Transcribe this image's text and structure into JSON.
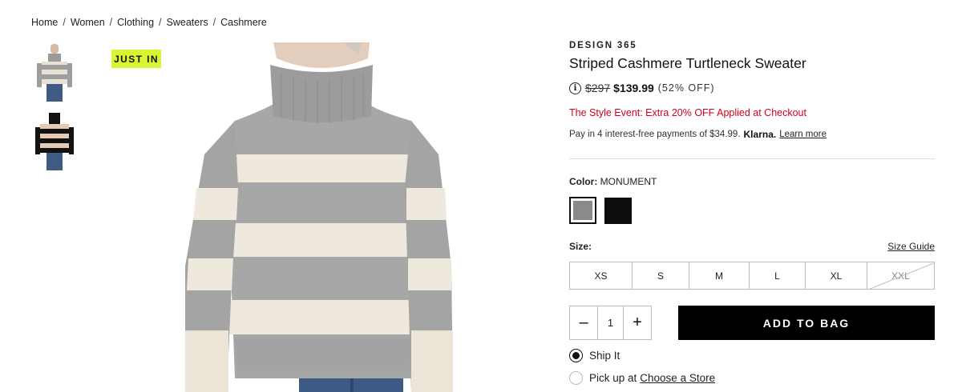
{
  "breadcrumb": {
    "items": [
      {
        "label": "Home"
      },
      {
        "label": "Women"
      },
      {
        "label": "Clothing"
      },
      {
        "label": "Sweaters"
      },
      {
        "label": "Cashmere"
      }
    ],
    "separator": "/"
  },
  "badge": {
    "label": "JUST IN",
    "color": "#d9f531"
  },
  "product": {
    "brand": "DESIGN 365",
    "title": "Striped Cashmere Turtleneck Sweater",
    "info_icon": "i",
    "original_price": "$297",
    "sale_price": "$139.99",
    "discount": "(52% OFF)",
    "promo": "The Style Event: Extra 20% OFF Applied at Checkout",
    "klarna_text": "Pay in 4 interest-free payments of $34.99.",
    "klarna_brand": "Klarna.",
    "klarna_link": "Learn more"
  },
  "color": {
    "label": "Color:",
    "selected": "MONUMENT",
    "swatches": [
      {
        "hex": "#8a8a8a",
        "selected": true
      },
      {
        "hex": "#0d0d0d",
        "selected": false
      }
    ]
  },
  "size": {
    "label": "Size:",
    "guide": "Size Guide",
    "options": [
      {
        "label": "XS",
        "available": true
      },
      {
        "label": "S",
        "available": true
      },
      {
        "label": "M",
        "available": true
      },
      {
        "label": "L",
        "available": true
      },
      {
        "label": "XL",
        "available": true
      },
      {
        "label": "XXL",
        "available": false
      }
    ]
  },
  "quantity": {
    "minus": "–",
    "value": "1",
    "plus": "+"
  },
  "add_to_bag": "ADD TO BAG",
  "fulfillment": {
    "ship": "Ship It",
    "pickup": "Pick up at",
    "store_link": "Choose a Store"
  },
  "colors": {
    "promo": "#d0021b",
    "accent": "#000000",
    "badge": "#d9f531"
  }
}
